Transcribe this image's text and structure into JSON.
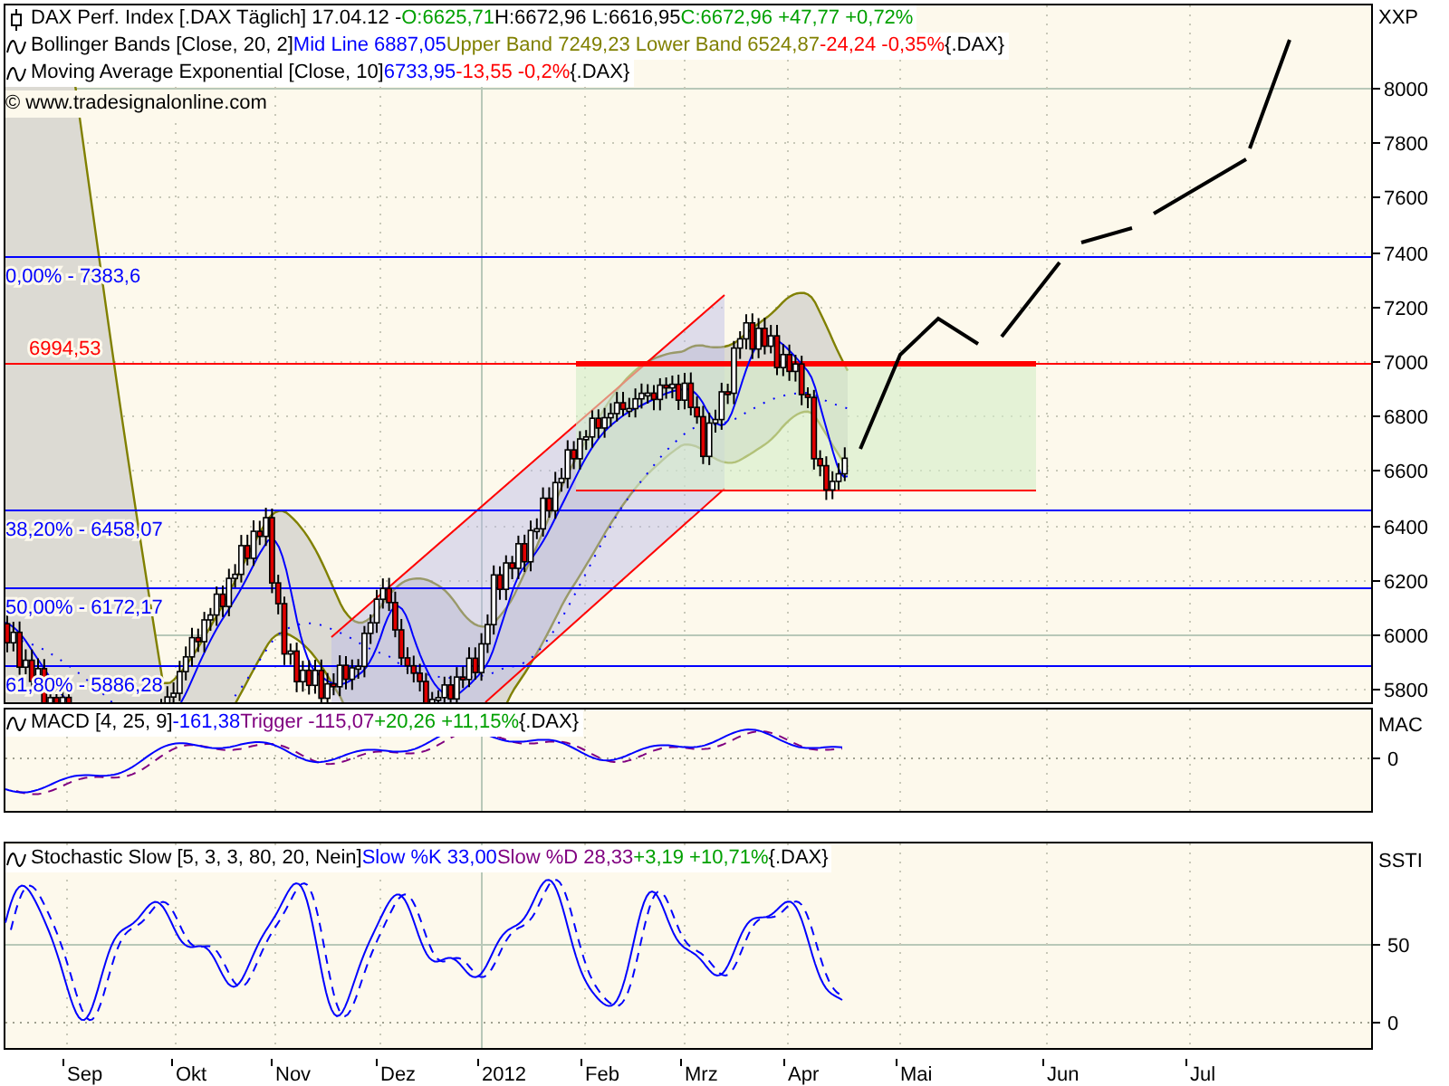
{
  "price_panel": {
    "legend": [
      {
        "kind": "price",
        "parts": [
          {
            "text": "DAX Perf. Index [.DAX  Täglich] 17.04.12 -",
            "color": "#000000"
          },
          {
            "text": "O:6625,71",
            "color": "#00a000"
          },
          {
            "text": "H:6672,96 L:6616,95",
            "color": "#000000"
          },
          {
            "text": "C:6672,96 +47,77 +0,72%",
            "color": "#00a000"
          }
        ]
      },
      {
        "kind": "indicator",
        "parts": [
          {
            "text": "Bollinger Bands [Close, 20, 2]",
            "color": "#000000"
          },
          {
            "text": "Mid Line 6887,05",
            "color": "#0000ff"
          },
          {
            "text": "Upper Band 7249,23 Lower Band 6524,87",
            "color": "#808000"
          },
          {
            "text": "-24,24 -0,35%",
            "color": "#ff0000"
          },
          {
            "text": "{.DAX}",
            "color": "#000000"
          }
        ]
      },
      {
        "kind": "indicator",
        "parts": [
          {
            "text": "Moving Average Exponential [Close, 10]",
            "color": "#000000"
          },
          {
            "text": "6733,95",
            "color": "#0000ff"
          },
          {
            "text": "-13,55 -0,2%",
            "color": "#ff0000"
          },
          {
            "text": "{.DAX}",
            "color": "#000000"
          }
        ]
      }
    ],
    "copyright": "© www.tradesignalonline.com",
    "levels": [
      {
        "label": "0,00% - 7383,6",
        "color": "#0000ff"
      },
      {
        "label": "6994,53",
        "color": "#ff0000"
      },
      {
        "label": "38,20% - 6458,07",
        "color": "#0000ff"
      },
      {
        "label": "50,00% - 6172,17",
        "color": "#0000ff"
      },
      {
        "label": "61,80% - 5886,28",
        "color": "#0000ff"
      }
    ],
    "axis_title": "XXP",
    "axis_ticks": [
      "8000",
      "7800",
      "7600",
      "7400",
      "7200",
      "7000",
      "6800",
      "6600",
      "6400",
      "6200",
      "6000",
      "5800"
    ]
  },
  "macd_panel": {
    "legend": {
      "parts": [
        {
          "text": "MACD [4, 25, 9]",
          "color": "#000000"
        },
        {
          "text": "-161,38",
          "color": "#0000ff"
        },
        {
          "text": "Trigger -115,07",
          "color": "#800080"
        },
        {
          "text": "+20,26 +11,15%",
          "color": "#00a000"
        },
        {
          "text": "{.DAX}",
          "color": "#000000"
        }
      ]
    },
    "axis_title": "MAC",
    "axis_ticks": [
      "0"
    ]
  },
  "stochastic_panel": {
    "legend": {
      "parts": [
        {
          "text": "Stochastic Slow [5, 3, 3, 80, 20, Nein]",
          "color": "#000000"
        },
        {
          "text": "Slow %K 33,00",
          "color": "#0000ff"
        },
        {
          "text": "Slow %D 28,33",
          "color": "#800080"
        },
        {
          "text": "+3,19 +10,71%",
          "color": "#00a000"
        },
        {
          "text": "{.DAX}",
          "color": "#000000"
        }
      ]
    },
    "axis_title": "SSTI",
    "axis_ticks": [
      "50",
      "0"
    ]
  },
  "time_axis": [
    "Sep",
    "Okt",
    "Nov",
    "Dez",
    "2012",
    "Feb",
    "Mrz",
    "Apr",
    "Mai",
    "Jun",
    "Jul"
  ]
}
